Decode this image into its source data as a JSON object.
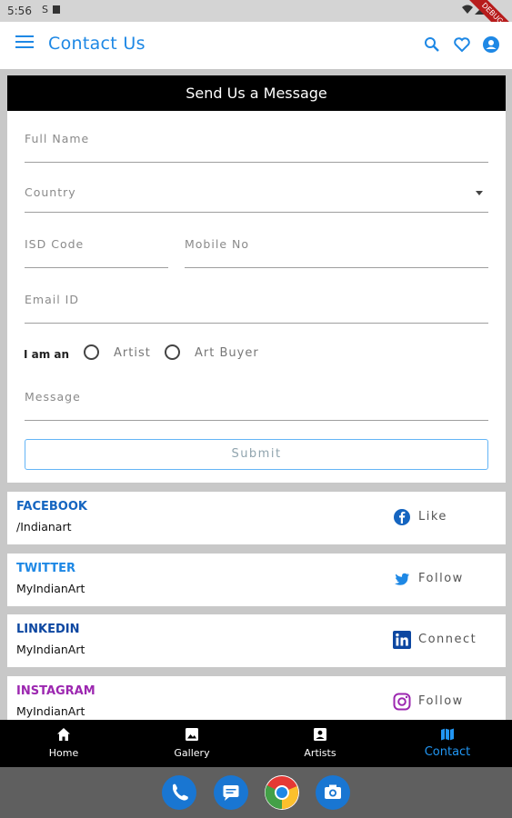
{
  "status_bar": {
    "time": "5:56",
    "debug_label": "DEBUG"
  },
  "app_bar": {
    "title": "Contact Us"
  },
  "form": {
    "header": "Send Us a Message",
    "full_name_placeholder": "Full Name",
    "country_placeholder": "Country",
    "isd_placeholder": "ISD Code",
    "mobile_placeholder": "Mobile No",
    "email_placeholder": "Email ID",
    "iam_label": "I am an",
    "radio_artist": "Artist",
    "radio_buyer": "Art Buyer",
    "message_placeholder": "Message",
    "submit_label": "Submit"
  },
  "social": [
    {
      "name": "FACEBOOK",
      "handle": "/Indianart",
      "action": "Like",
      "color": "#1565c0"
    },
    {
      "name": "TWITTER",
      "handle": "MyIndianArt",
      "action": "Follow",
      "color": "#1e88e5"
    },
    {
      "name": "LINKEDIN",
      "handle": "MyIndianArt",
      "action": "Connect",
      "color": "#0d47a1"
    },
    {
      "name": "INSTAGRAM",
      "handle": "MyIndianArt",
      "action": "Follow",
      "color": "#9c27b0"
    }
  ],
  "bottom_nav": [
    {
      "label": "Home",
      "icon": "home-icon",
      "active": false
    },
    {
      "label": "Gallery",
      "icon": "gallery-icon",
      "active": false
    },
    {
      "label": "Artists",
      "icon": "artists-icon",
      "active": false
    },
    {
      "label": "Contact",
      "icon": "map-icon",
      "active": true
    }
  ],
  "colors": {
    "accent": "#1e88e5",
    "active_nav": "#2196f3",
    "header_bg": "#000000"
  },
  "dock": [
    "phone-icon",
    "messages-icon",
    "chrome-icon",
    "camera-icon"
  ]
}
